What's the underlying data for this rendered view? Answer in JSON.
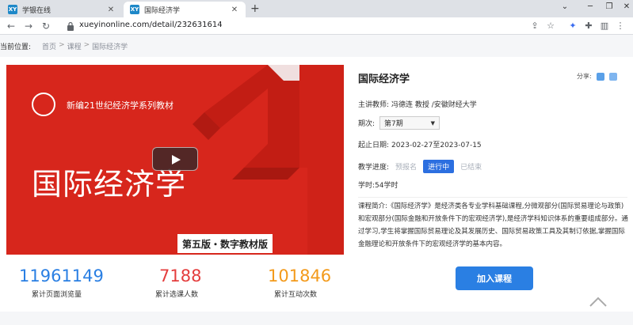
{
  "browser": {
    "tabs": [
      {
        "title": "学银在线",
        "favicon": "XY"
      },
      {
        "title": "国际经济学",
        "favicon": "XY"
      }
    ],
    "url": "xueyinonline.com/detail/232631614"
  },
  "breadcrumb": {
    "label": "当前位置:",
    "items": [
      "首页",
      "课程",
      "国际经济学"
    ],
    "separator": ">"
  },
  "cover": {
    "series_text": "新编21世纪经济学系列教材",
    "title_text": "国际经济学",
    "edition_text": "第五版・数字教材版",
    "background_color": "#d7261c"
  },
  "course": {
    "title": "国际经济学",
    "share_label": "分享:",
    "teacher_label": "主讲教师:",
    "teacher_value": "冯德连 教授 /安徽财经大学",
    "period_label": "期次:",
    "period_value": "第7期",
    "dates_label": "起止日期:",
    "dates_value": "2023-02-27至2023-07-15",
    "progress_label": "教学进度:",
    "progress_states": [
      "预报名",
      "进行中",
      "已结束"
    ],
    "hours_label": "学时:",
    "hours_value": "54学时",
    "summary_label": "课程简介:",
    "summary_text": "《国际经济学》是经济类各专业学科基础课程,分微观部分(国际贸易理论与政策)和宏观部分(国际金融和开放条件下的宏观经济学),是经济学科知识体系的重要组成部分。通过学习,学生将掌握国际贸易理论及其发展历史、国际贸易政策工具及其制订依据,掌握国际金融理论和开放条件下的宏观经济学的基本内容。"
  },
  "stats": [
    {
      "value": "11961149",
      "label": "累计页面浏览量",
      "color": "#2a7fe3"
    },
    {
      "value": "7188",
      "label": "累计选课人数",
      "color": "#e43d3d"
    },
    {
      "value": "101846",
      "label": "累计互动次数",
      "color": "#f39a1b"
    }
  ],
  "actions": {
    "join_label": "加入课程"
  },
  "colors": {
    "accent": "#2a7fe3",
    "status_active": "#2c6fe0"
  }
}
